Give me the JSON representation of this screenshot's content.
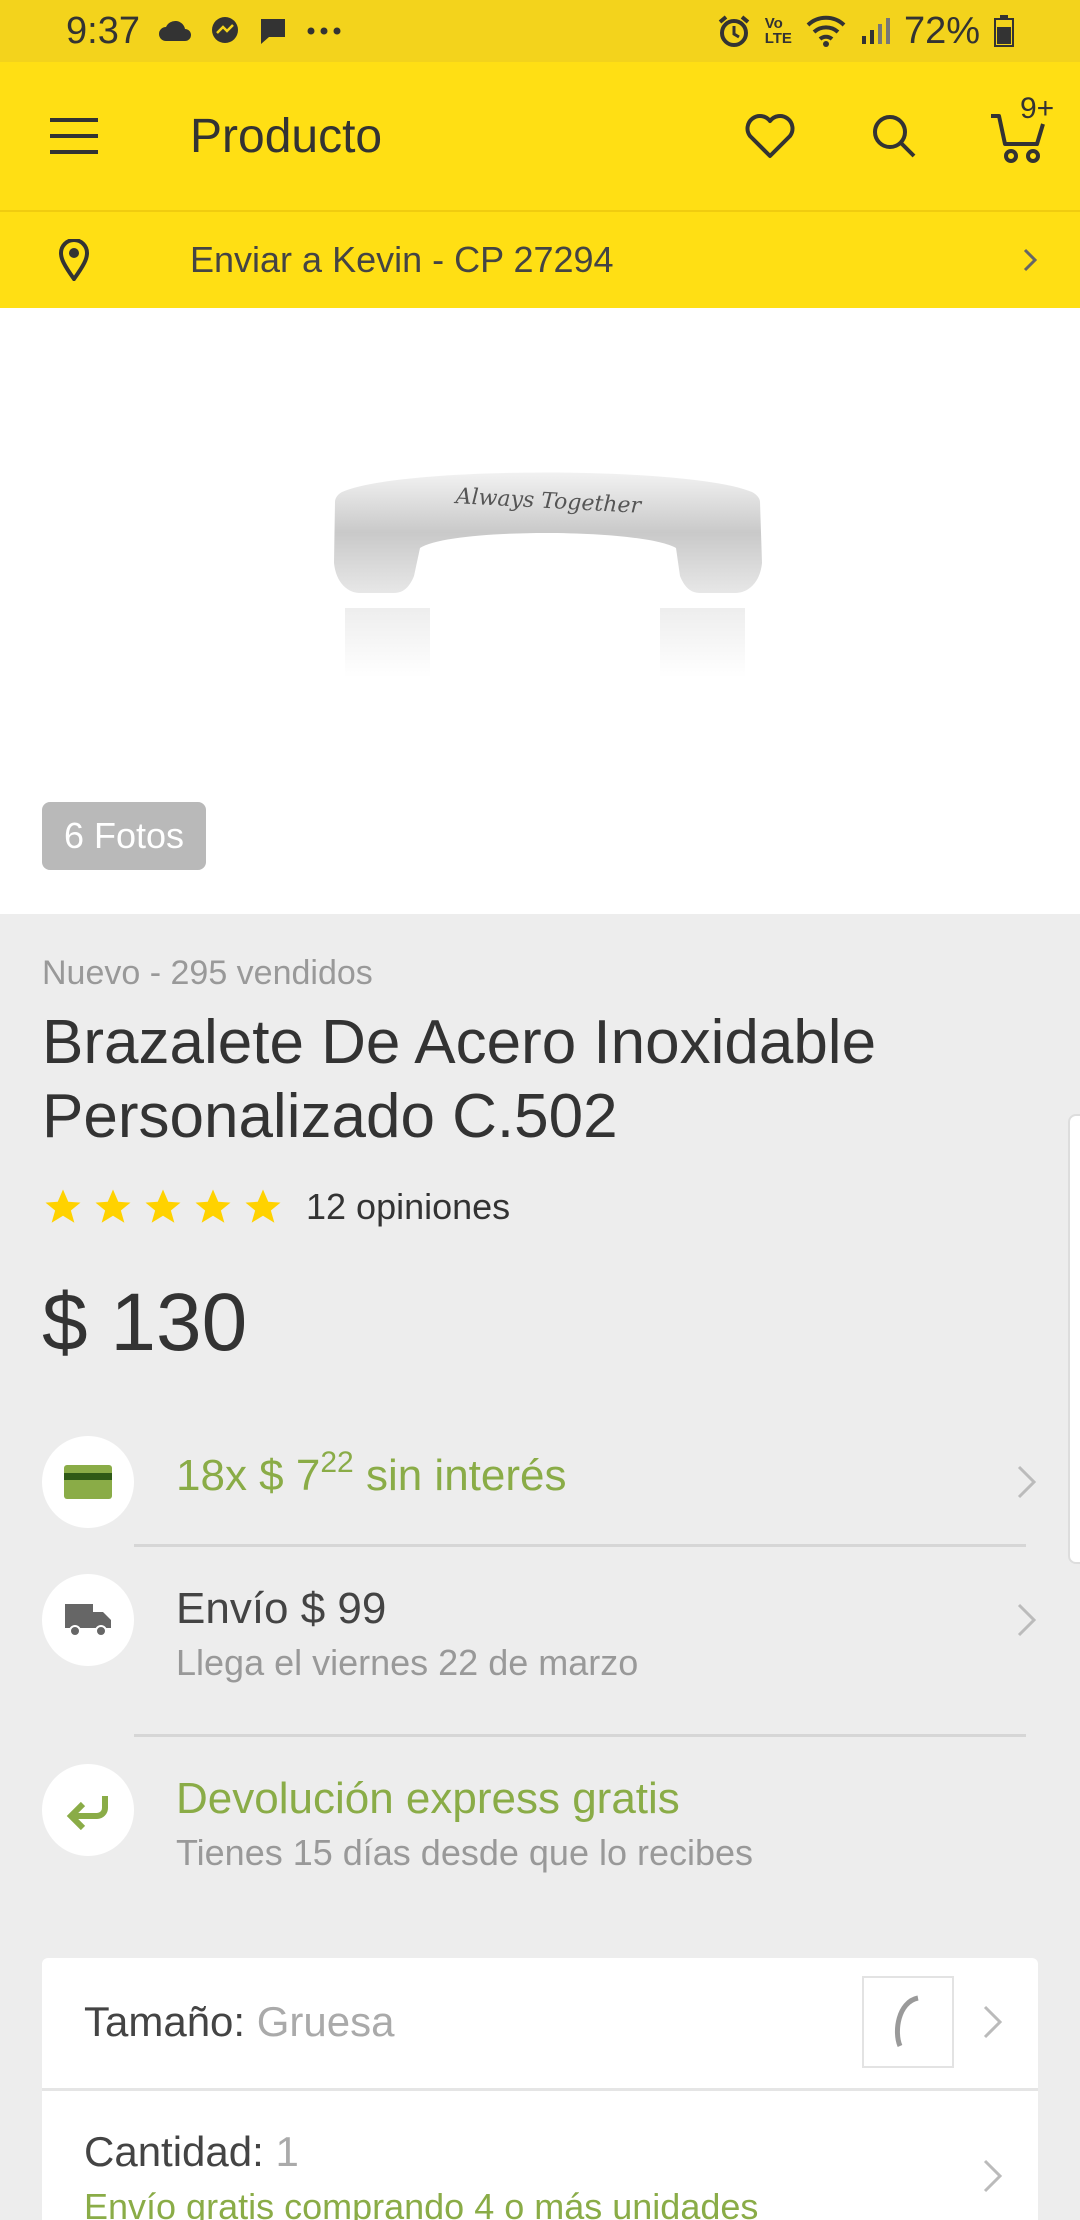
{
  "status_bar": {
    "time": "9:37",
    "battery": "72%",
    "lte_label_top": "Vo",
    "lte_label_bottom": "LTE"
  },
  "app_bar": {
    "title": "Producto",
    "cart_badge": "9+"
  },
  "shipping_bar": {
    "text": "Enviar a Kevin - CP 27294"
  },
  "gallery": {
    "photos_label": "6 Fotos",
    "engraving": "Always Together"
  },
  "product": {
    "condition": "Nuevo - 295 vendidos",
    "title": "Brazalete De Acero Inoxidable Personalizado C.502",
    "rating": 5,
    "reviews": "12 opiniones",
    "price": "$ 130"
  },
  "installments": {
    "prefix": "18x $ 7",
    "cents": "22",
    "suffix": "sin interés"
  },
  "shipping": {
    "title": "Envío $ 99",
    "subtitle": "Llega el viernes 22 de marzo"
  },
  "returns": {
    "title": "Devolución express gratis",
    "subtitle": "Tienes 15 días desde que lo recibes"
  },
  "options": {
    "size_label": "Tamaño:",
    "size_value": "Gruesa",
    "qty_label": "Cantidad:",
    "qty_value": "1",
    "qty_note": "Envío gratis comprando 4 o más unidades"
  },
  "colors": {
    "brand_yellow": "#ffdf14",
    "status_yellow": "#f3d31c",
    "green": "#8aac47",
    "star": "#ffd200"
  }
}
